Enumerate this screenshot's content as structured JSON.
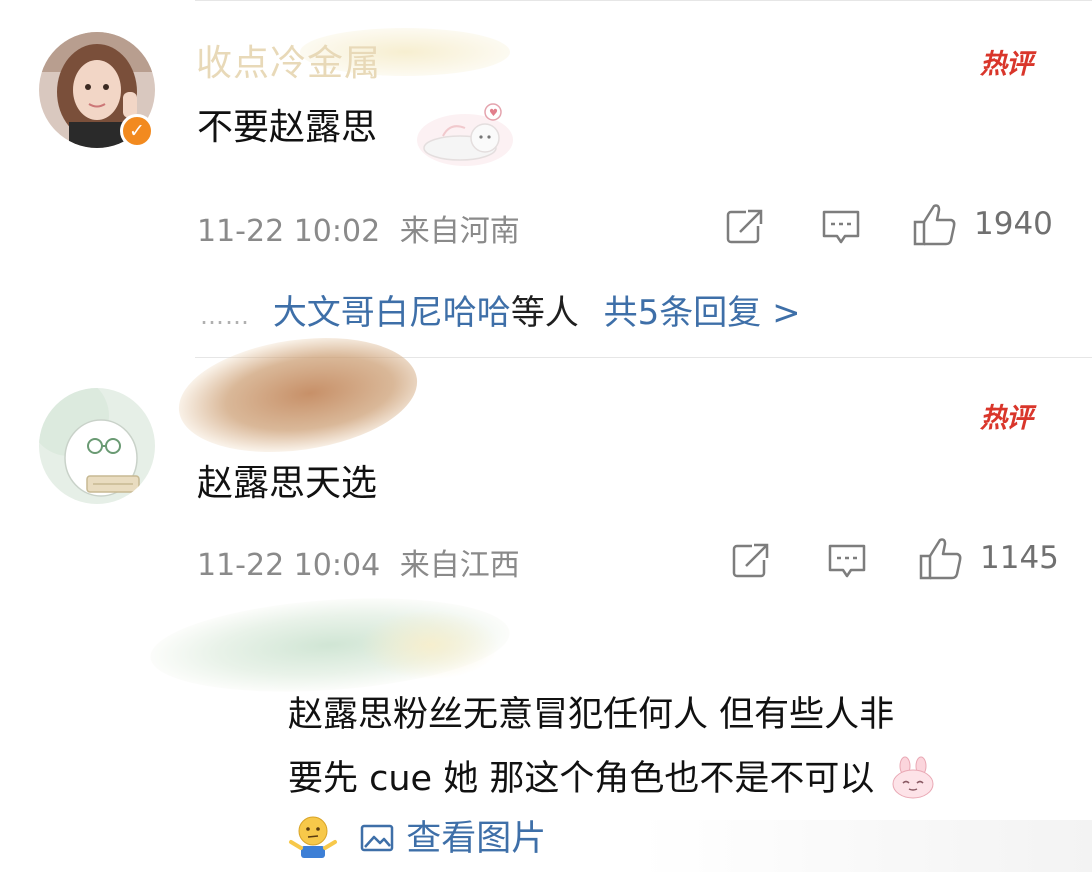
{
  "comments": [
    {
      "username": "收点冷金属",
      "hot_label": "热评",
      "text": "不要赵露思",
      "time": "11-22 10:02",
      "location": "来自河南",
      "likes": "1940",
      "replies": {
        "dots": "……",
        "names": "大文哥白尼哈哈",
        "suffix": "等人",
        "count_text": "共5条回复 >"
      }
    },
    {
      "hot_label": "热评",
      "text": "赵露思天选",
      "time": "11-22 10:04",
      "location": "来自江西",
      "likes": "1145"
    },
    {
      "text_line1": "赵露思粉丝无意冒犯任何人 但有些人非",
      "text_line2": "要先 cue 她 那这个角色也不是不可以",
      "view_pictures": "查看图片"
    }
  ],
  "icons": [
    "share-icon",
    "comment-icon",
    "like-icon",
    "verified-icon",
    "picture-icon"
  ],
  "colors": {
    "link": "#3e6fa8",
    "hot": "#d9362b",
    "meta": "#8a8a8a",
    "verified": "#f28a1f"
  }
}
